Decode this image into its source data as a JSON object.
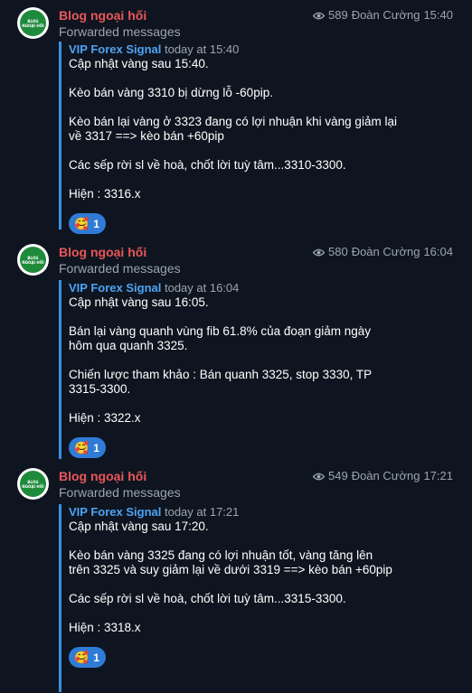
{
  "messages": [
    {
      "sender": "Blog ngoại hối",
      "forwarded_label": "Forwarded messages",
      "views": "589",
      "author": "Đoàn Cường",
      "time": "15:40",
      "fwd_source": "VIP Forex Signal",
      "fwd_time": "today at 15:40",
      "paragraphs": [
        [
          "Cập nhật vàng sau 15:40."
        ],
        [
          "Kèo bán vàng 3310 bị dừng lỗ -60pip."
        ],
        [
          "Kèo bán lại vàng ở 3323 đang có lợi nhuận khi vàng giảm lại",
          "về 3317 ==> kèo bán +60pip"
        ],
        [
          "Các sếp rời sl về hoà, chốt lời tuỳ tâm...3310-3300."
        ],
        [
          "Hiện : 3316.x"
        ]
      ],
      "reaction": {
        "emoji": "🥰",
        "count": "1"
      }
    },
    {
      "sender": "Blog ngoại hối",
      "forwarded_label": "Forwarded messages",
      "views": "580",
      "author": "Đoàn Cường",
      "time": "16:04",
      "fwd_source": "VIP Forex Signal",
      "fwd_time": "today at 16:04",
      "paragraphs": [
        [
          "Cập nhật vàng sau 16:05."
        ],
        [
          "Bán lại vàng quanh vùng fib 61.8% của đoạn giảm ngày",
          "hôm qua quanh 3325."
        ],
        [
          "Chiến lược tham khảo : Bán quanh 3325, stop 3330, TP",
          "3315-3300."
        ],
        [
          "Hiện : 3322.x"
        ]
      ],
      "reaction": {
        "emoji": "🥰",
        "count": "1"
      }
    },
    {
      "sender": "Blog ngoại hối",
      "forwarded_label": "Forwarded messages",
      "views": "549",
      "author": "Đoàn Cường",
      "time": "17:21",
      "fwd_source": "VIP Forex Signal",
      "fwd_time": "today at 17:21",
      "paragraphs": [
        [
          "Cập nhật vàng sau 17:20."
        ],
        [
          "Kèo bán vàng 3325 đang có lợi nhuận tốt, vàng tăng lên",
          "trên 3325 và suy giảm lại về dưới 3319 ==> kèo bán +60pip"
        ],
        [
          "Các sếp rời sl về hoà, chốt lời tuỳ tâm...3315-3300."
        ],
        [
          "Hiện : 3318.x"
        ]
      ],
      "reaction": {
        "emoji": "🥰",
        "count": "1"
      }
    }
  ],
  "avatar_text": [
    "BLOG",
    "NGOẠI HỐI"
  ],
  "colors": {
    "background": "#0f1520",
    "sender": "#e8575a",
    "forward_source": "#4ea4f5",
    "forward_bar": "#3a8fe0",
    "reaction_bg": "#2f7cd7",
    "muted": "#9aa4b1"
  },
  "icons": {
    "views": "eye-icon",
    "reaction": "smiling-face-with-hearts-emoji"
  }
}
